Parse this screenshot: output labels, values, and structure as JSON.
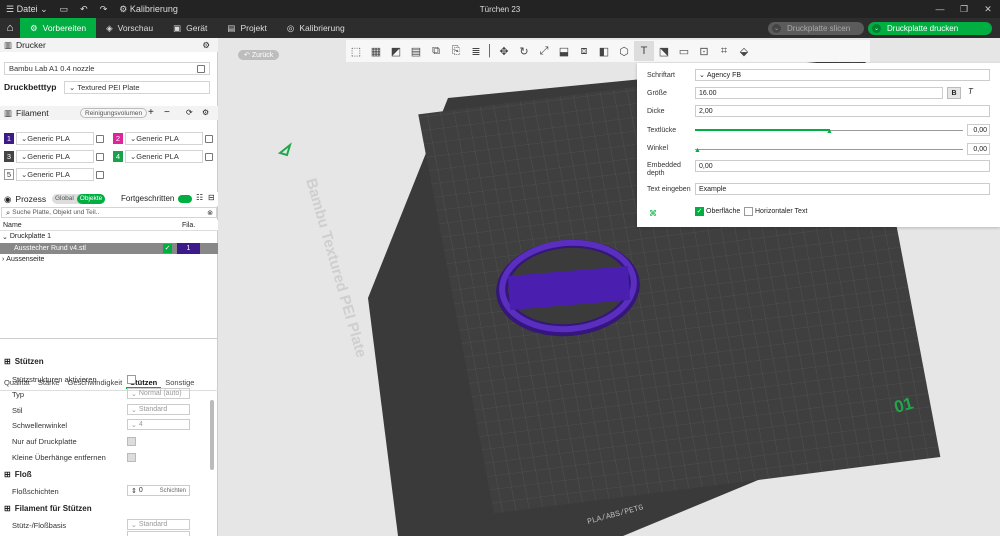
{
  "titlebar": {
    "file_label": "Datei",
    "calibration": "Kalibrierung",
    "title": "Türchen 23"
  },
  "menu": {
    "tabs": [
      "Vorbereiten",
      "Vorschau",
      "Gerät",
      "Projekt",
      "Kalibrierung"
    ],
    "slice": "Druckplatte slicen",
    "print": "Druckplatte drucken"
  },
  "printer": {
    "head": "Drucker",
    "name": "Bambu Lab A1 0.4 nozzle",
    "bed_label": "Druckbetttyp",
    "bed_value": "Textured PEI Plate"
  },
  "filament": {
    "head": "Filament",
    "purge": "Reinigungsvolumen",
    "items": [
      {
        "num": "1",
        "name": "Generic PLA",
        "color": "#3d1a8a"
      },
      {
        "num": "2",
        "name": "Generic PLA",
        "color": "#e0239b"
      },
      {
        "num": "3",
        "name": "Generic PLA",
        "color": "#444444"
      },
      {
        "num": "4",
        "name": "Generic PLA",
        "color": "#17a34a"
      },
      {
        "num": "5",
        "name": "Generic PLA",
        "color": "#ffffff"
      }
    ]
  },
  "process": {
    "head": "Prozess",
    "global": "Global",
    "objects": "Objekte",
    "advanced": "Fortgeschritten",
    "search_placeholder": "Suche Platte, Objekt und Teil..",
    "col_name": "Name",
    "col_fila": "Fila.",
    "plate": "Druckplatte 1",
    "object": "Ausstecher Rund v4.stl",
    "object_fila": "1",
    "outside": "Aussenseite"
  },
  "param_tabs": [
    "Qualität",
    "Stärke",
    "Geschwindigkeit",
    "Stützen",
    "Sonstige"
  ],
  "supports": {
    "head": "Stützen",
    "enable": "Stützstrukturen aktivieren",
    "type_label": "Typ",
    "type_value": "Normal (auto)",
    "style_label": "Stil",
    "style_value": "Standard",
    "threshold_label": "Schwellenwinkel",
    "threshold_value": "4",
    "only_plate": "Nur auf Druckplatte",
    "remove_small": "Kleine Überhänge entfernen"
  },
  "raft": {
    "head": "Floß",
    "layers_label": "Floßschichten",
    "layers_value": "0",
    "layers_unit": "Schichten"
  },
  "filament_support": {
    "head": "Filament für Stützen",
    "base_label": "Stütz-/Floßbasis",
    "base_value": "Standard"
  },
  "viewport": {
    "back": "Zurück",
    "plate_text": "Bambu Textured PEI Plate",
    "plate_num": "01",
    "plate_labels": "PLA/ABS/PETG"
  },
  "text_panel": {
    "font_label": "Schriftart",
    "font_value": "Agency FB",
    "size_label": "Größe",
    "size_value": "16.00",
    "bold": "B",
    "italic": "T",
    "thick_label": "Dicke",
    "thick_value": "2,00",
    "gap_label": "Textlücke",
    "gap_value": "0,00",
    "angle_label": "Winkel",
    "angle_value": "0,00",
    "embed_label": "Embedded depth",
    "embed_value": "0,00",
    "text_label": "Text eingeben",
    "text_value": "Example",
    "surface": "Oberfläche",
    "horizontal": "Horizontaler Text"
  }
}
